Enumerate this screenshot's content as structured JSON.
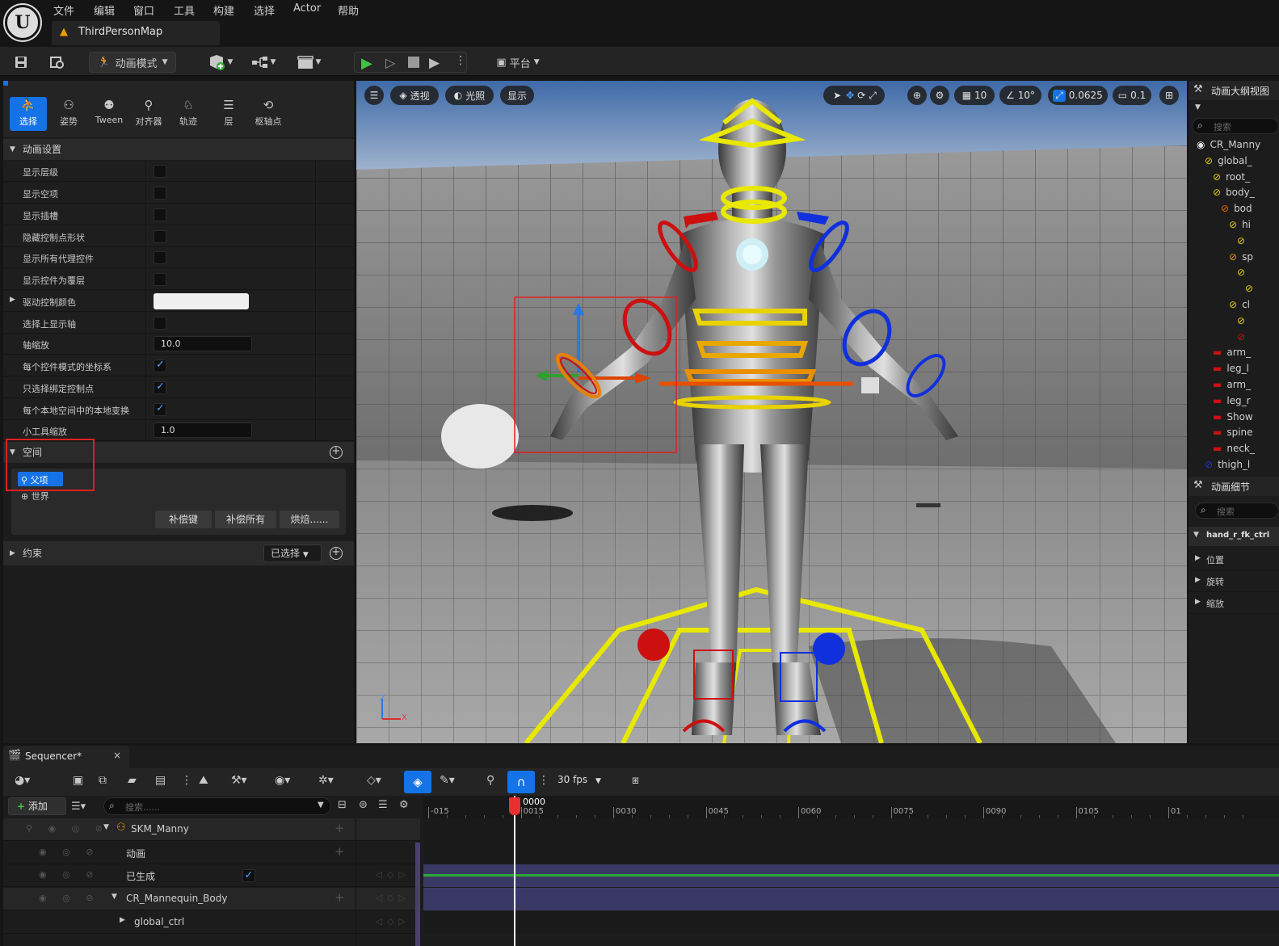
{
  "menubar": {
    "items": [
      "文件",
      "编辑",
      "窗口",
      "工具",
      "构建",
      "选择",
      "Actor",
      "帮助"
    ],
    "map_tab": "ThirdPersonMap"
  },
  "toolbar": {
    "mode_label": "动画模式",
    "platform_label": "平台"
  },
  "modes": [
    {
      "label": "选择",
      "icon": "select-icon"
    },
    {
      "label": "姿势",
      "icon": "pose-icon"
    },
    {
      "label": "Tween",
      "icon": "tween-icon"
    },
    {
      "label": "对齐器",
      "icon": "aligner-icon"
    },
    {
      "label": "轨迹",
      "icon": "trail-icon"
    },
    {
      "label": "层",
      "icon": "layer-icon"
    },
    {
      "label": "枢轴点",
      "icon": "pivot-icon"
    }
  ],
  "anim_settings": {
    "title": "动画设置",
    "rows": [
      {
        "label": "显示层级",
        "type": "check",
        "checked": false
      },
      {
        "label": "显示空项",
        "type": "check",
        "checked": false
      },
      {
        "label": "显示插槽",
        "type": "check",
        "checked": false
      },
      {
        "label": "隐藏控制点形状",
        "type": "check",
        "checked": false
      },
      {
        "label": "显示所有代理控件",
        "type": "check",
        "checked": false
      },
      {
        "label": "显示控件为覆层",
        "type": "check",
        "checked": false
      },
      {
        "label": "驱动控制颜色",
        "type": "color",
        "color": "#f0f0f0"
      },
      {
        "label": "选择上显示轴",
        "type": "check",
        "checked": false
      },
      {
        "label": "轴缩放",
        "type": "number",
        "value": "10.0"
      },
      {
        "label": "每个控件模式的坐标系",
        "type": "check",
        "checked": true
      },
      {
        "label": "只选择绑定控制点",
        "type": "check",
        "checked": true
      },
      {
        "label": "每个本地空间中的本地变换",
        "type": "check",
        "checked": true
      },
      {
        "label": "小工具缩放",
        "type": "number",
        "value": "1.0"
      }
    ]
  },
  "space": {
    "title": "空间",
    "parent": "父项",
    "world": "世界",
    "buttons": [
      "补偿键",
      "补偿所有",
      "烘焙......"
    ]
  },
  "constraints": {
    "title": "约束",
    "dropdown": "已选择"
  },
  "viewport": {
    "perspective": "透视",
    "lighting": "光照",
    "show": "显示",
    "grid": "10",
    "angle": "10°",
    "scale": "0.0625",
    "camera_speed": "0.1",
    "axis_x": "X",
    "axis_z": "Z"
  },
  "outliner": {
    "title": "动画大纲视图",
    "search_placeholder": "搜索",
    "items": [
      {
        "label": "CR_Manny",
        "indent": 0,
        "color": "#e0e0e0"
      },
      {
        "label": "global_",
        "indent": 1,
        "color": "#e8d200"
      },
      {
        "label": "root_",
        "indent": 2,
        "color": "#e8d200"
      },
      {
        "label": "body_",
        "indent": 2,
        "color": "#e8d200"
      },
      {
        "label": "bod",
        "indent": 3,
        "color": "#e86a00"
      },
      {
        "label": "hi",
        "indent": 4,
        "color": "#e8d200"
      },
      {
        "label": "",
        "indent": 5,
        "color": "#e8d200"
      },
      {
        "label": "sp",
        "indent": 4,
        "color": "#e8a000"
      },
      {
        "label": "",
        "indent": 5,
        "color": "#e8d200"
      },
      {
        "label": "",
        "indent": 6,
        "color": "#e8d200"
      },
      {
        "label": "cl",
        "indent": 4,
        "color": "#e8d200"
      },
      {
        "label": "",
        "indent": 5,
        "color": "#e8d200"
      },
      {
        "label": "",
        "indent": 5,
        "color": "#cc1010"
      },
      {
        "label": "arm_",
        "indent": 2,
        "color": "#cc1010"
      },
      {
        "label": "leg_l",
        "indent": 2,
        "color": "#cc1010"
      },
      {
        "label": "arm_",
        "indent": 2,
        "color": "#cc1010"
      },
      {
        "label": "leg_r",
        "indent": 2,
        "color": "#cc1010"
      },
      {
        "label": "Show",
        "indent": 2,
        "color": "#cc1010"
      },
      {
        "label": "spine",
        "indent": 2,
        "color": "#cc1010"
      },
      {
        "label": "neck_",
        "indent": 2,
        "color": "#cc1010"
      },
      {
        "label": "thigh_l",
        "indent": 1,
        "color": "#2030d0"
      }
    ]
  },
  "details": {
    "title": "动画细节",
    "search_placeholder": "搜索",
    "control": "hand_r_fk_ctrl",
    "sections": [
      "位置",
      "旋转",
      "缩放"
    ]
  },
  "sequencer": {
    "tab": "Sequencer*",
    "fps": "30 fps",
    "add_label": "添加",
    "search_placeholder": "搜索......",
    "current_frame": "0000",
    "ticks": [
      "-015",
      "0015",
      "0030",
      "0045",
      "0060",
      "0075",
      "0090",
      "0105",
      "01"
    ],
    "tracks": [
      {
        "label": "SKM_Manny",
        "indent": 0,
        "expand": true,
        "add": true
      },
      {
        "label": "动画",
        "indent": 1,
        "expand": false,
        "add": true
      },
      {
        "label": "已生成",
        "indent": 1,
        "expand": false,
        "add": false,
        "check": true
      },
      {
        "label": "CR_Mannequin_Body",
        "indent": 1,
        "expand": true,
        "add": true
      },
      {
        "label": "global_ctrl",
        "indent": 2,
        "expand": false,
        "add": false
      }
    ]
  }
}
